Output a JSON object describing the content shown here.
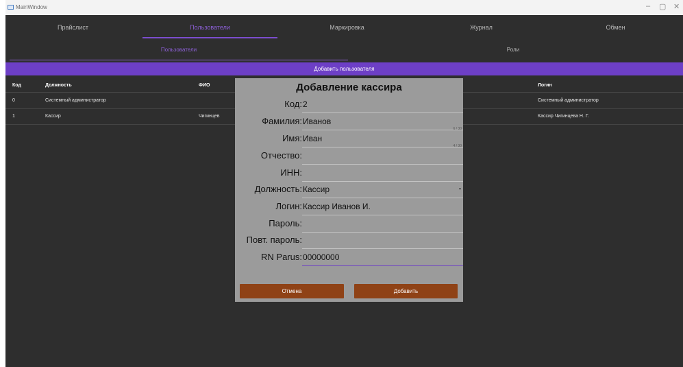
{
  "window": {
    "title": "MainWindow",
    "minimize": "–",
    "maximize": "▢",
    "close": "✕"
  },
  "top_tabs": [
    "Прайслист",
    "Пользователи",
    "Маркировка",
    "Журнал",
    "Обмен"
  ],
  "sub_tabs": [
    "Пользователи",
    "Роли"
  ],
  "add_user_label": "Добавить пользователя",
  "table": {
    "headers": {
      "code": "Код",
      "position": "Должность",
      "fio": "ФИО",
      "login": "Логин"
    },
    "rows": [
      {
        "code": "0",
        "position": "Системный администратор",
        "fio": "",
        "login": "Системный администратор"
      },
      {
        "code": "1",
        "position": "Кассир",
        "fio": "Чигинцев",
        "login": "Кассир Чигинцева Н. Г."
      }
    ]
  },
  "dialog": {
    "title": "Добавление кассира",
    "fields": {
      "code": {
        "label": "Код:",
        "value": "2"
      },
      "surname": {
        "label": "Фамилия:",
        "value": "Иванов",
        "counter": "6 / 30"
      },
      "name": {
        "label": "Имя:",
        "value": "Иван",
        "counter": "4 / 30"
      },
      "patronymic": {
        "label": "Отчество:",
        "value": ""
      },
      "inn": {
        "label": "ИНН:",
        "value": ""
      },
      "position": {
        "label": "Должность:",
        "value": "Кассир",
        "arrow": "▼"
      },
      "login": {
        "label": "Логин:",
        "value": "Кассир Иванов И."
      },
      "password": {
        "label": "Пароль:",
        "value": ""
      },
      "password_repeat": {
        "label": "Повт. пароль:",
        "value": ""
      },
      "rn_parus": {
        "label": "RN Parus:",
        "value": "00000000"
      }
    },
    "cancel_label": "Отмена",
    "add_label": "Добавить"
  },
  "colors": {
    "accent": "#6d3fc6",
    "button": "#8f4216",
    "background": "#2e2e2e",
    "dialog": "#9b9b9b"
  }
}
